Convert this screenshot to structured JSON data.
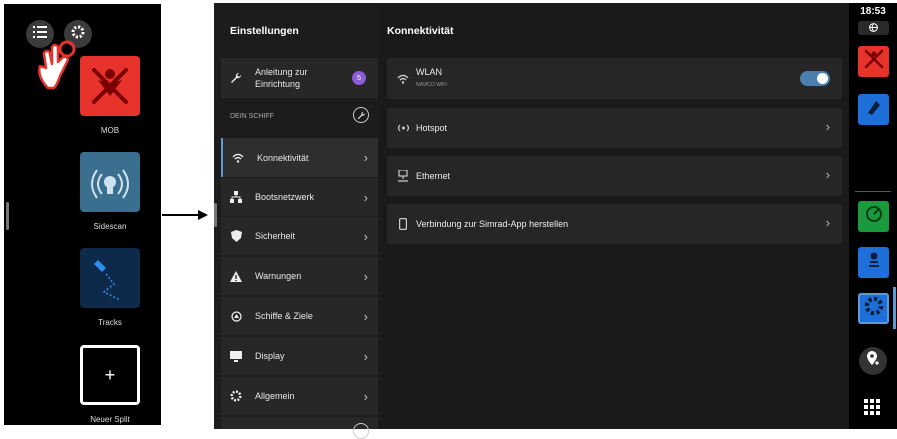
{
  "left_panel": {
    "menu_icon": "list-icon",
    "settings_icon": "gear-icon",
    "tiles": [
      {
        "label": "MOB",
        "color": "#e8322c",
        "icon": "mob-icon"
      },
      {
        "label": "Sidescan",
        "color": "#3a6f8f",
        "icon": "sidescan-icon"
      },
      {
        "label": "Tracks",
        "color": "#0d2a4a",
        "icon": "tracks-icon"
      },
      {
        "label": "Neuer Split",
        "color": "#000000",
        "icon": "plus-icon"
      }
    ],
    "new_split_symbol": "+"
  },
  "settings": {
    "title": "Einstellungen",
    "setup_guide": {
      "label_line1": "Anleitung zur",
      "label_line2": "Einrichtung",
      "badge": "5"
    },
    "section_header": "DEIN SCHIFF",
    "items": [
      {
        "label": "Konnektivität",
        "icon": "wifi-icon"
      },
      {
        "label": "Bootsnetzwerk",
        "icon": "network-icon"
      },
      {
        "label": "Sicherheit",
        "icon": "shield-icon"
      },
      {
        "label": "Warnungen",
        "icon": "warning-icon"
      },
      {
        "label": "Schiffe & Ziele",
        "icon": "vessel-icon"
      },
      {
        "label": "Display",
        "icon": "display-icon"
      },
      {
        "label": "Allgemein",
        "icon": "gear-icon"
      }
    ]
  },
  "content": {
    "title": "Konnektivität",
    "wlan": {
      "label": "WLAN",
      "sublabel": "NAVICO WIFI",
      "enabled": true
    },
    "cards": [
      {
        "label": "Hotspot",
        "icon": "hotspot-icon"
      },
      {
        "label": "Ethernet",
        "icon": "ethernet-icon"
      },
      {
        "label": "Verbindung zur Simrad-App herstellen",
        "icon": "phone-icon"
      }
    ]
  },
  "status": {
    "time": "18:53"
  },
  "colors": {
    "accent": "#5a9bd5",
    "badge": "#8a5cd6",
    "mob": "#e8322c",
    "blue_app": "#1e6fd9",
    "green_app": "#1a9a3c"
  }
}
